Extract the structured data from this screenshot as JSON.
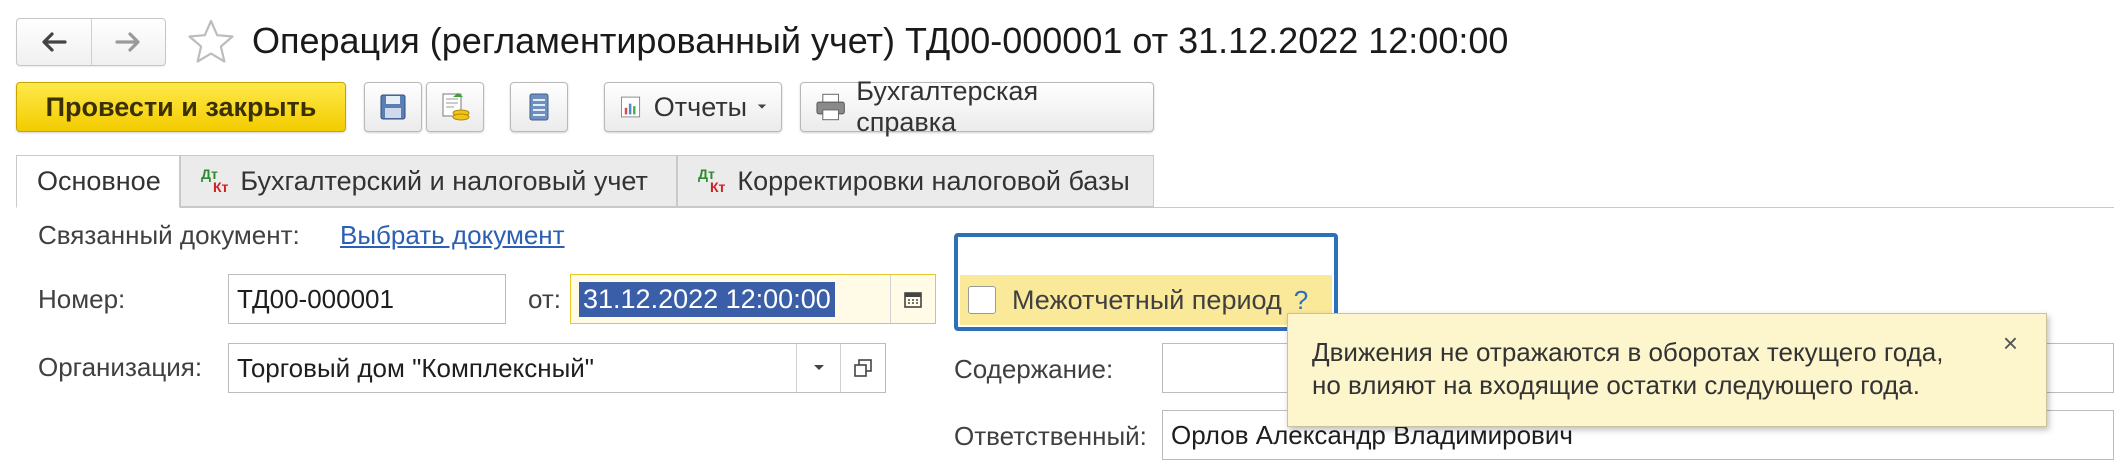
{
  "window": {
    "title": "Операция (регламентированный учет) ТД00-000001 от 31.12.2022 12:00:00"
  },
  "nav": {
    "back_icon": "arrow-left-icon",
    "forward_icon": "arrow-right-icon",
    "favorite_icon": "star-icon"
  },
  "toolbar": {
    "post_close_label": "Провести и закрыть",
    "save_icon": "floppy-disk-icon",
    "post_icon": "post-document-icon",
    "list_icon": "list-icon",
    "reports_label": "Отчеты",
    "reference_label": "Бухгалтерская справка"
  },
  "tabs": [
    {
      "label": "Основное"
    },
    {
      "label": "Бухгалтерский и налоговый учет",
      "badge_top": "Дт",
      "badge_bottom": "Кт"
    },
    {
      "label": "Корректировки налоговой базы",
      "badge_top": "Дт",
      "badge_bottom": "Кт"
    }
  ],
  "form": {
    "linked_doc_label": "Связанный документ:",
    "linked_doc_link": "Выбрать документ",
    "number_label": "Номер:",
    "number_value": "ТД00-000001",
    "from_label": "от:",
    "date_value": "31.12.2022 12:00:00",
    "interperiod_label": "Межотчетный период",
    "help_mark": "?",
    "org_label": "Организация:",
    "org_value": "Торговый дом \"Комплексный\"",
    "content_label": "Содержание:",
    "content_value": "",
    "responsible_label": "Ответственный:",
    "responsible_value": "Орлов Александр Владимирович"
  },
  "tooltip": {
    "line1": "Движения не отражаются в оборотах текущего года,",
    "line2": "но влияют на входящие остатки следующего года.",
    "close": "×"
  },
  "colors": {
    "primary_button": "#f3cc00",
    "focus_border": "#2d6fb8",
    "tooltip_bg": "#fdf6cd",
    "link": "#2b5fb3",
    "selection": "#3a5ea8"
  }
}
